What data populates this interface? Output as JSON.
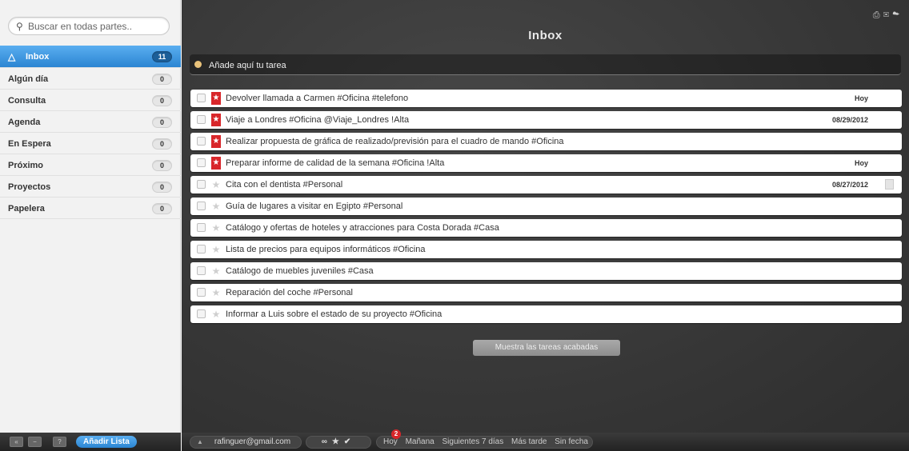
{
  "search": {
    "placeholder": "Buscar en todas partes..",
    "value": ""
  },
  "sidebar": {
    "lists": [
      {
        "label": "Inbox",
        "count": "11",
        "active": true
      },
      {
        "label": "Algún día",
        "count": "0"
      },
      {
        "label": "Consulta",
        "count": "0"
      },
      {
        "label": "Agenda",
        "count": "0"
      },
      {
        "label": "En Espera",
        "count": "0"
      },
      {
        "label": "Próximo",
        "count": "0"
      },
      {
        "label": "Proyectos",
        "count": "0"
      },
      {
        "label": "Papelera",
        "count": "0"
      }
    ],
    "footer": {
      "add_list_label": "Añadir Lista",
      "help_label": "?"
    }
  },
  "main": {
    "title": "Inbox",
    "add_task_placeholder": "Añade aquí tu tarea",
    "show_done_label": "Muestra las tareas acabadas"
  },
  "tasks": [
    {
      "text": "Devolver llamada a Carmen #Oficina #telefono",
      "starred": true,
      "due": "Hoy"
    },
    {
      "text": "Viaje a Londres #Oficina @Viaje_Londres !Alta",
      "starred": true,
      "due": "08/29/2012"
    },
    {
      "text": "Realizar propuesta de gráfica de realizado/previsión para el cuadro de mando #Oficina",
      "starred": true,
      "due": ""
    },
    {
      "text": "Preparar informe de calidad de la semana #Oficina !Alta",
      "starred": true,
      "due": "Hoy"
    },
    {
      "text": "Cita con el dentista #Personal",
      "starred": false,
      "due": "08/27/2012",
      "note": true
    },
    {
      "text": "Guía de lugares a visitar en Egipto #Personal",
      "starred": false,
      "due": ""
    },
    {
      "text": "Catálogo y ofertas de hoteles y atracciones para Costa Dorada #Casa",
      "starred": false,
      "due": ""
    },
    {
      "text": "Lista de precios para equipos informáticos #Oficina",
      "starred": false,
      "due": ""
    },
    {
      "text": "Catálogo de muebles juveniles #Casa",
      "starred": false,
      "due": ""
    },
    {
      "text": "Reparación del coche #Personal",
      "starred": false,
      "due": ""
    },
    {
      "text": "Informar a Luis sobre el estado de su proyecto #Oficina",
      "starred": false,
      "due": ""
    }
  ],
  "bottom_bar": {
    "user_email": "rafinguer@gmail.com",
    "today_badge": "2",
    "date_filters": [
      "Hoy",
      "Mañana",
      "Siguientes 7 días",
      "Más tarde",
      "Sin fecha"
    ]
  }
}
